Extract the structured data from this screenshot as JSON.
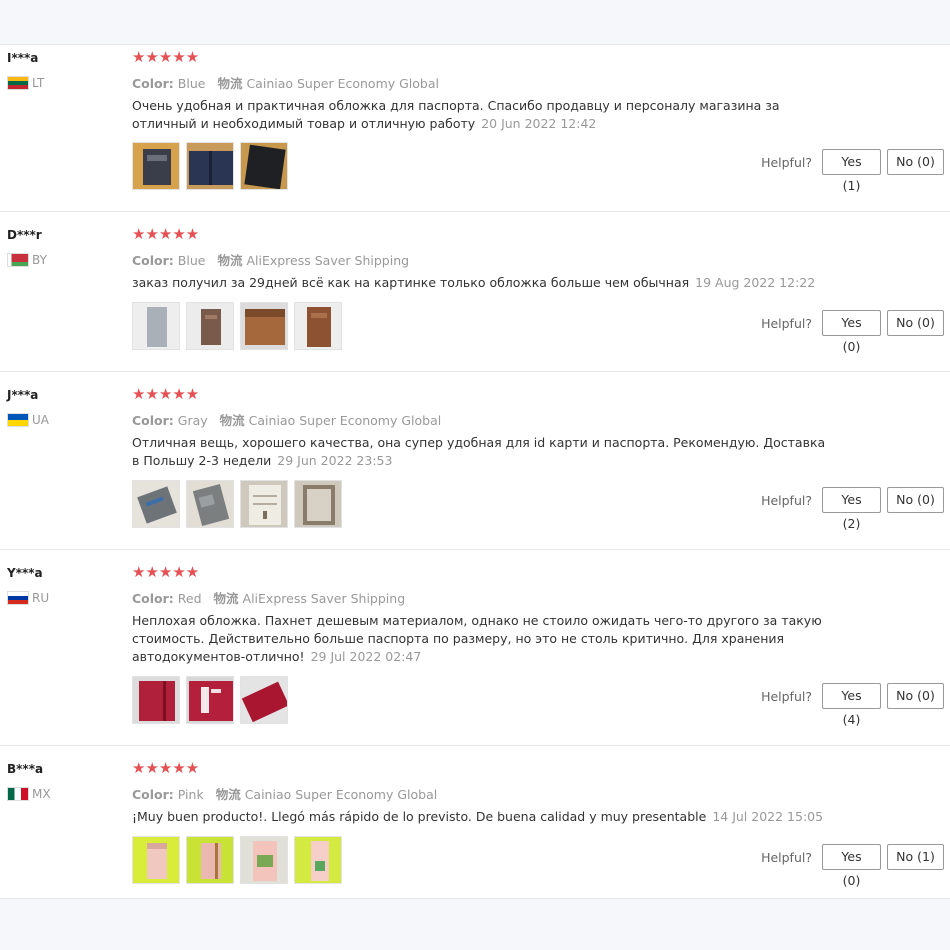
{
  "labels": {
    "color": "Color:",
    "shipping": "物流",
    "helpful": "Helpful?"
  },
  "colors": {
    "star": "#e55256",
    "border": "#e8e8e8"
  },
  "reviews": [
    {
      "user": "I***a",
      "country": "LT",
      "flag": "lithuania-flag-icon",
      "stars": "★★★★★",
      "color": "Blue",
      "shipping": "Cainiao Super Economy Global",
      "text": "Очень удобная и практичная обложка для паспорта. Спасибо продавцу и персоналу магазина за отличный и необходимый товар и отличную работу",
      "date": "20 Jun 2022 12:42",
      "thumbs": [
        "photo-thumbnail",
        "photo-thumbnail",
        "photo-thumbnail"
      ],
      "yes": "Yes (1)",
      "no": "No (0)"
    },
    {
      "user": "D***r",
      "country": "BY",
      "flag": "belarus-flag-icon",
      "stars": "★★★★★",
      "color": "Blue",
      "shipping": "AliExpress Saver Shipping",
      "text": "заказ получил за 29дней всё как на картинке только обложка больше чем обычная",
      "date": "19 Aug 2022 12:22",
      "thumbs": [
        "photo-thumbnail",
        "photo-thumbnail",
        "photo-thumbnail",
        "photo-thumbnail"
      ],
      "yes": "Yes (0)",
      "no": "No (0)"
    },
    {
      "user": "J***a",
      "country": "UA",
      "flag": "ukraine-flag-icon",
      "stars": "★★★★★",
      "color": "Gray",
      "shipping": "Cainiao Super Economy Global",
      "text": "Отличная вещь, хорошего качества, она супер удобная для id карти и паспорта. Рекомендую. Доставка в Польшу 2-3 недели",
      "date": "29 Jun 2022 23:53",
      "thumbs": [
        "photo-thumbnail",
        "photo-thumbnail",
        "photo-thumbnail",
        "photo-thumbnail"
      ],
      "yes": "Yes (2)",
      "no": "No (0)"
    },
    {
      "user": "Y***a",
      "country": "RU",
      "flag": "russia-flag-icon",
      "stars": "★★★★★",
      "color": "Red",
      "shipping": "AliExpress Saver Shipping",
      "text": "Неплохая обложка. Пахнет дешевым материалом, однако не стоило ожидать чего-то другого за такую стоимость. Действительно больше паспорта по размеру, но это не столь критично. Для хранения автодокументов-отлично!",
      "date": "29 Jul 2022 02:47",
      "thumbs": [
        "photo-thumbnail",
        "photo-thumbnail",
        "photo-thumbnail"
      ],
      "yes": "Yes (4)",
      "no": "No (0)"
    },
    {
      "user": "B***a",
      "country": "MX",
      "flag": "mexico-flag-icon",
      "stars": "★★★★★",
      "color": "Pink",
      "shipping": "Cainiao Super Economy Global",
      "text": "¡Muy buen producto!. Llegó más rápido de lo previsto. De buena calidad y muy presentable",
      "date": "14 Jul 2022 15:05",
      "thumbs": [
        "photo-thumbnail",
        "photo-thumbnail",
        "photo-thumbnail",
        "photo-thumbnail"
      ],
      "yes": "Yes (0)",
      "no": "No (1)"
    }
  ]
}
